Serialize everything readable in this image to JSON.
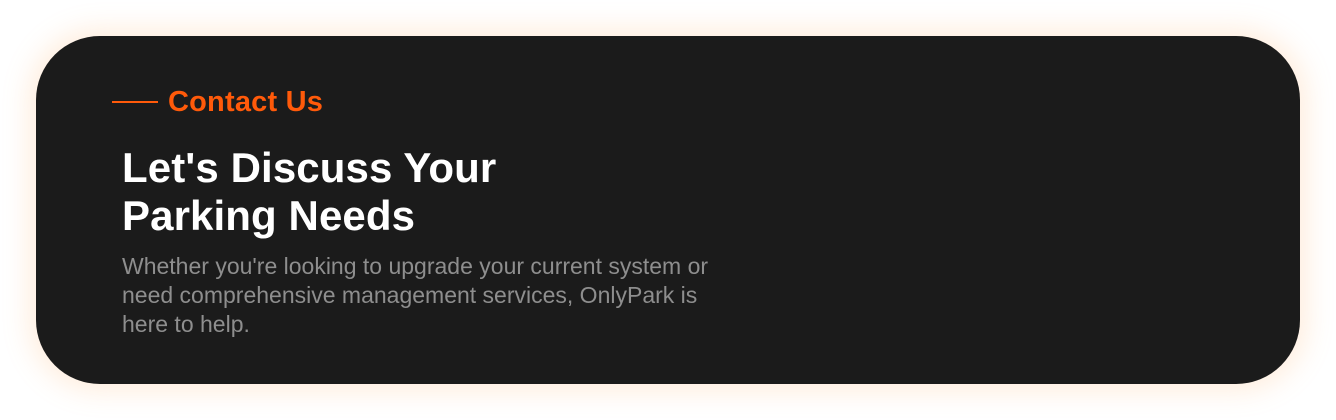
{
  "section": {
    "eyebrow": "Contact Us",
    "headline_lines": [
      "Let's Discuss Your",
      "Parking Needs"
    ],
    "description_lines": [
      "Whether you're looking to upgrade your current system or",
      "need comprehensive management services, OnlyPark is",
      "here to help."
    ]
  },
  "colors": {
    "accent": "#ff5a0a",
    "card_background": "#1b1b1b",
    "heading": "#ffffff",
    "body_text": "#8e8e8e",
    "glow": "#ffaa5a"
  }
}
